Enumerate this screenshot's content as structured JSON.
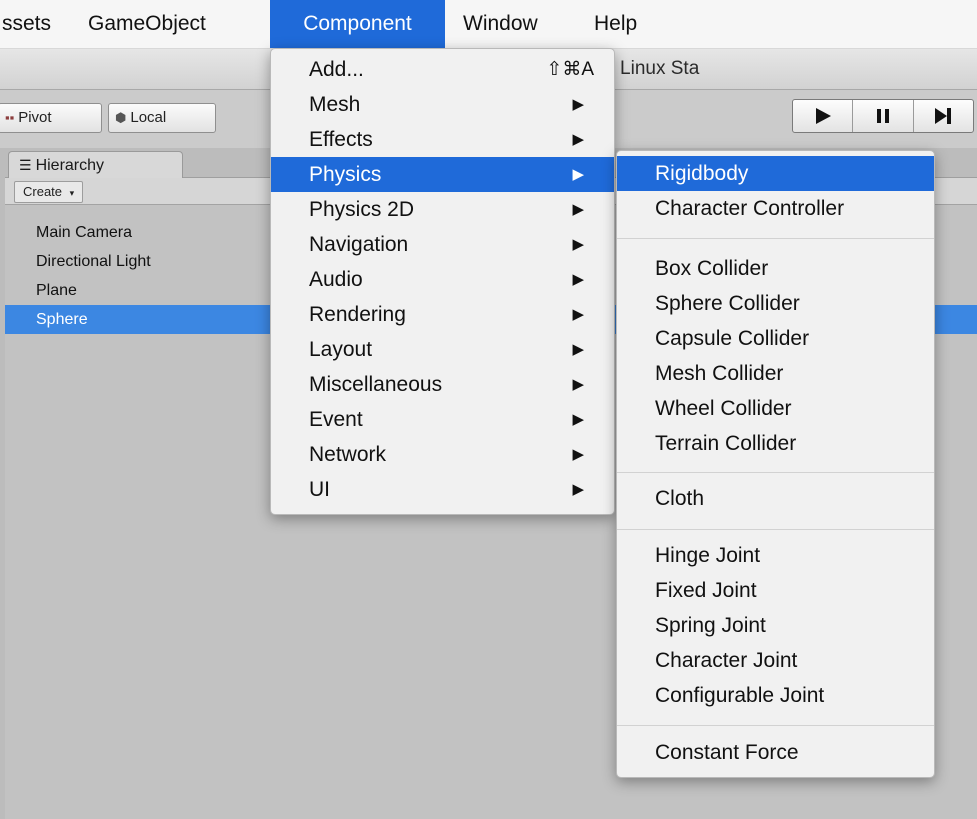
{
  "menubar": {
    "items": [
      "ssets",
      "GameObject",
      "Component",
      "Window",
      "Help"
    ]
  },
  "window": {
    "title": "ractice03 - PC, Mac & Linux Sta"
  },
  "toolbar": {
    "pivot_label": "Pivot",
    "local_label": "Local",
    "play_icon": "play-icon",
    "pause_icon": "pause-icon",
    "step_icon": "step-icon"
  },
  "hierarchy": {
    "tab_label": "Hierarchy",
    "create_label": "Create",
    "items": [
      "Main Camera",
      "Directional Light",
      "Plane",
      "Sphere"
    ],
    "selected": "Sphere"
  },
  "component_menu": {
    "add": {
      "label": "Add...",
      "shortcut": "⇧⌘A"
    },
    "items": [
      {
        "label": "Mesh"
      },
      {
        "label": "Effects"
      },
      {
        "label": "Physics"
      },
      {
        "label": "Physics 2D"
      },
      {
        "label": "Navigation"
      },
      {
        "label": "Audio"
      },
      {
        "label": "Rendering"
      },
      {
        "label": "Layout"
      },
      {
        "label": "Miscellaneous"
      },
      {
        "label": "Event"
      },
      {
        "label": "Network"
      },
      {
        "label": "UI"
      }
    ],
    "highlighted": "Physics"
  },
  "physics_submenu": {
    "groups": [
      [
        "Rigidbody",
        "Character Controller"
      ],
      [
        "Box Collider",
        "Sphere Collider",
        "Capsule Collider",
        "Mesh Collider",
        "Wheel Collider",
        "Terrain Collider"
      ],
      [
        "Cloth"
      ],
      [
        "Hinge Joint",
        "Fixed Joint",
        "Spring Joint",
        "Character Joint",
        "Configurable Joint"
      ],
      [
        "Constant Force"
      ]
    ],
    "highlighted": "Rigidbody"
  },
  "colors": {
    "highlight": "#1f6ad9",
    "selection": "#3c87e2"
  }
}
